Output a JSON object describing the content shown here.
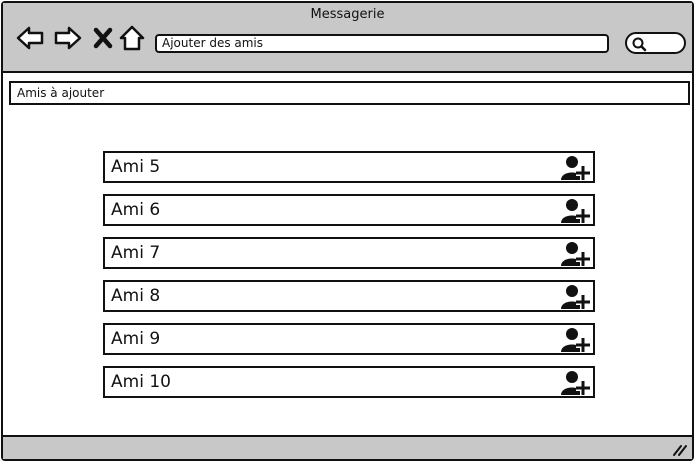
{
  "window": {
    "title": "Messagerie"
  },
  "toolbar": {
    "back_icon": "arrow-left-icon",
    "forward_icon": "arrow-right-icon",
    "close_icon": "close-icon",
    "home_icon": "home-icon",
    "address": "Ajouter des amis",
    "search_icon": "search-icon"
  },
  "section": {
    "label": "Amis à ajouter"
  },
  "friends": [
    {
      "name": "Ami 5",
      "action_icon": "add-user-icon"
    },
    {
      "name": "Ami 6",
      "action_icon": "add-user-icon"
    },
    {
      "name": "Ami 7",
      "action_icon": "add-user-icon"
    },
    {
      "name": "Ami 8",
      "action_icon": "add-user-icon"
    },
    {
      "name": "Ami 9",
      "action_icon": "add-user-icon"
    },
    {
      "name": "Ami 10",
      "action_icon": "add-user-icon"
    }
  ],
  "colors": {
    "chrome": "#c8c8c8",
    "outline": "#111111",
    "content": "#ffffff"
  }
}
